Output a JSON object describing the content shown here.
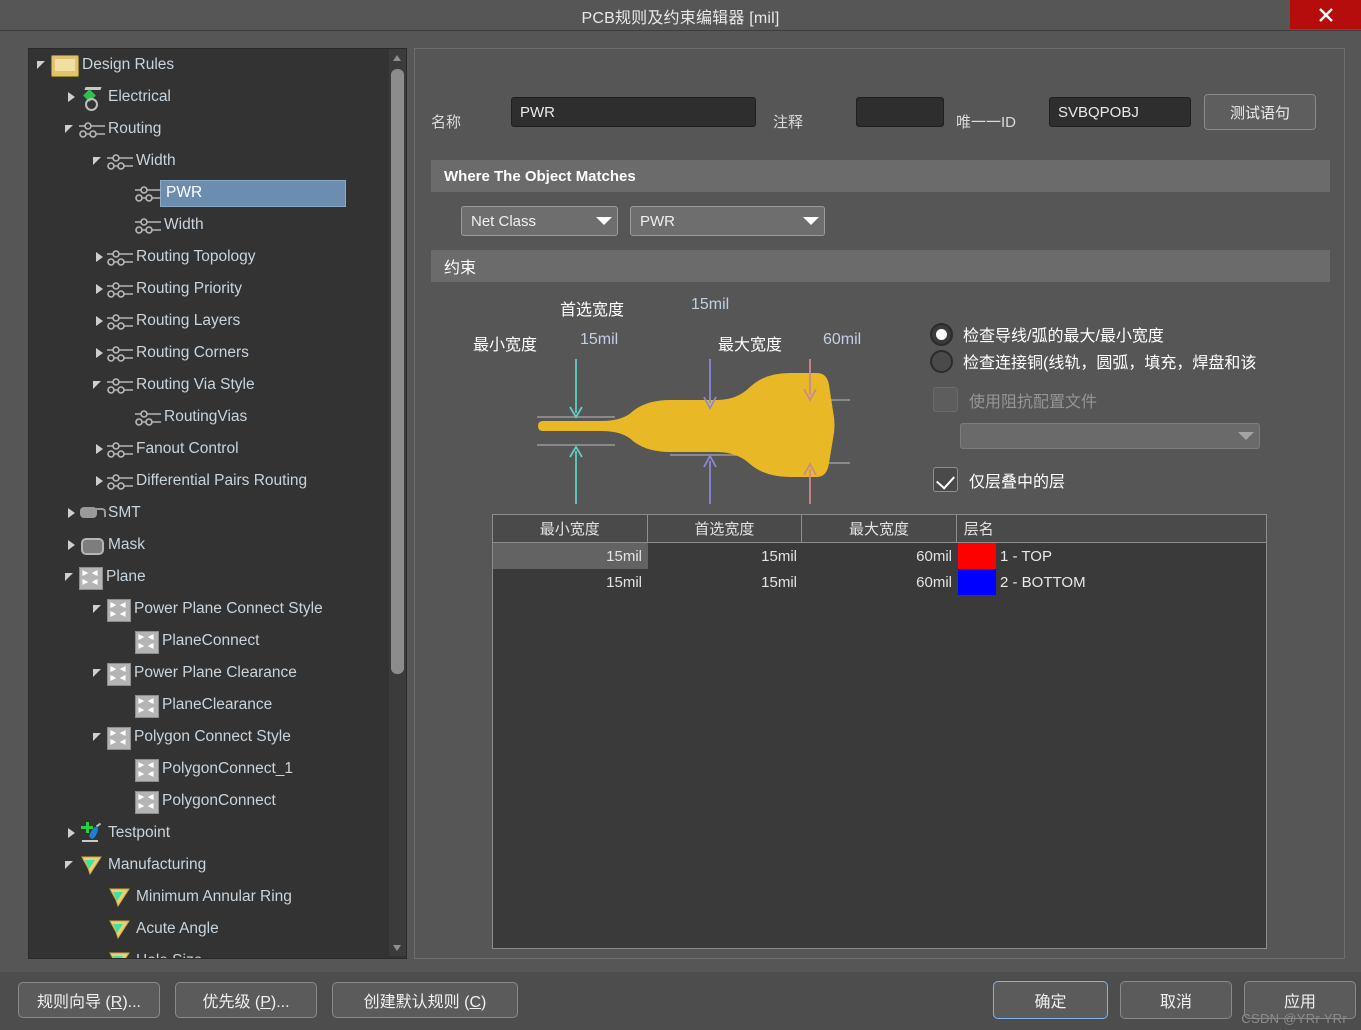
{
  "window": {
    "title": "PCB规则及约束编辑器 [mil]",
    "close_label": "×"
  },
  "tree": {
    "items": [
      {
        "label": "Design Rules",
        "depth": 0,
        "icon": "folder-rules-icon",
        "state": "open",
        "selected": false
      },
      {
        "label": "Electrical",
        "depth": 1,
        "icon": "electrical-icon",
        "state": "closed",
        "selected": false
      },
      {
        "label": "Routing",
        "depth": 1,
        "icon": "routing-icon",
        "state": "open",
        "selected": false
      },
      {
        "label": "Width",
        "depth": 2,
        "icon": "routing-icon",
        "state": "open",
        "selected": false
      },
      {
        "label": "PWR",
        "depth": 3,
        "icon": "routing-icon",
        "state": "leaf",
        "selected": true
      },
      {
        "label": "Width",
        "depth": 3,
        "icon": "routing-icon",
        "state": "leaf",
        "selected": false
      },
      {
        "label": "Routing Topology",
        "depth": 2,
        "icon": "routing-icon",
        "state": "closed",
        "selected": false
      },
      {
        "label": "Routing Priority",
        "depth": 2,
        "icon": "routing-icon",
        "state": "closed",
        "selected": false
      },
      {
        "label": "Routing Layers",
        "depth": 2,
        "icon": "routing-icon",
        "state": "closed",
        "selected": false
      },
      {
        "label": "Routing Corners",
        "depth": 2,
        "icon": "routing-icon",
        "state": "closed",
        "selected": false
      },
      {
        "label": "Routing Via Style",
        "depth": 2,
        "icon": "routing-icon",
        "state": "open",
        "selected": false
      },
      {
        "label": "RoutingVias",
        "depth": 3,
        "icon": "routing-icon",
        "state": "leaf",
        "selected": false
      },
      {
        "label": "Fanout Control",
        "depth": 2,
        "icon": "routing-icon",
        "state": "closed",
        "selected": false
      },
      {
        "label": "Differential Pairs Routing",
        "depth": 2,
        "icon": "routing-icon",
        "state": "closed",
        "selected": false
      },
      {
        "label": "SMT",
        "depth": 1,
        "icon": "smt-icon",
        "state": "closed",
        "selected": false
      },
      {
        "label": "Mask",
        "depth": 1,
        "icon": "mask-icon",
        "state": "closed",
        "selected": false
      },
      {
        "label": "Plane",
        "depth": 1,
        "icon": "plane-icon",
        "state": "open",
        "selected": false
      },
      {
        "label": "Power Plane Connect Style",
        "depth": 2,
        "icon": "plane-icon",
        "state": "open",
        "selected": false
      },
      {
        "label": "PlaneConnect",
        "depth": 3,
        "icon": "plane-icon",
        "state": "leaf",
        "selected": false
      },
      {
        "label": "Power Plane Clearance",
        "depth": 2,
        "icon": "plane-icon",
        "state": "open",
        "selected": false
      },
      {
        "label": "PlaneClearance",
        "depth": 3,
        "icon": "plane-icon",
        "state": "leaf",
        "selected": false
      },
      {
        "label": "Polygon Connect Style",
        "depth": 2,
        "icon": "plane-icon",
        "state": "open",
        "selected": false
      },
      {
        "label": "PolygonConnect_1",
        "depth": 3,
        "icon": "plane-icon",
        "state": "leaf",
        "selected": false
      },
      {
        "label": "PolygonConnect",
        "depth": 3,
        "icon": "plane-icon",
        "state": "leaf",
        "selected": false
      },
      {
        "label": "Testpoint",
        "depth": 1,
        "icon": "testpoint-icon",
        "state": "closed",
        "selected": false
      },
      {
        "label": "Manufacturing",
        "depth": 1,
        "icon": "manufacturing-icon",
        "state": "open",
        "selected": false
      },
      {
        "label": "Minimum Annular Ring",
        "depth": 2,
        "icon": "manufacturing-icon",
        "state": "leaf",
        "selected": false
      },
      {
        "label": "Acute Angle",
        "depth": 2,
        "icon": "manufacturing-icon",
        "state": "leaf",
        "selected": false
      },
      {
        "label": "Hole Size",
        "depth": 2,
        "icon": "manufacturing-icon",
        "state": "leaf",
        "selected": false
      }
    ]
  },
  "form": {
    "name_label": "名称",
    "name_value": "PWR",
    "comment_label": "注释",
    "comment_value": "",
    "unique_id_label": "唯一一ID",
    "unique_id_value": "SVBQPOBJ",
    "test_query_button": "测试语句"
  },
  "where_section": {
    "header": "Where The Object Matches",
    "scope_value": "Net Class",
    "target_value": "PWR"
  },
  "constraints_section": {
    "header": "约束",
    "diagram": {
      "preferred_label": "首选宽度",
      "preferred_value": "15mil",
      "min_label": "最小宽度",
      "min_value": "15mil",
      "max_label": "最大宽度",
      "max_value": "60mil"
    },
    "options": {
      "radio1_label": "检查导线/弧的最大/最小宽度",
      "radio1_checked": true,
      "radio2_label": "检查连接铜(线轨，圆弧，填充，焊盘和该",
      "radio2_checked": false,
      "impedance_check_label": "使用阻抗配置文件",
      "impedance_checked": false,
      "impedance_combo_value": "",
      "stack_layers_label": "仅层叠中的层",
      "stack_layers_checked": true
    },
    "table": {
      "columns": [
        "最小宽度",
        "首选宽度",
        "最大宽度",
        "层名"
      ],
      "rows": [
        {
          "min": "15mil",
          "preferred": "15mil",
          "max": "60mil",
          "color": "#ff0000",
          "layer": "1 - TOP",
          "selected": true
        },
        {
          "min": "15mil",
          "preferred": "15mil",
          "max": "60mil",
          "color": "#0000ff",
          "layer": "2 - BOTTOM",
          "selected": false
        }
      ]
    }
  },
  "footer": {
    "rule_wizard": "规则向导 (R)...",
    "priority": "优先级 (P)...",
    "create_default": "创建默认规则 (C)",
    "ok": "确定",
    "cancel": "取消",
    "apply": "应用",
    "watermark": "CSDN @YRr YRr"
  },
  "colors": {
    "selection": "#6a8db0",
    "close": "#b50c0c",
    "trace": "#e8b826",
    "min_arrow": "#5ecfc0",
    "pref_arrow": "#8b8ad4",
    "max_arrow": "#c98b8b"
  }
}
